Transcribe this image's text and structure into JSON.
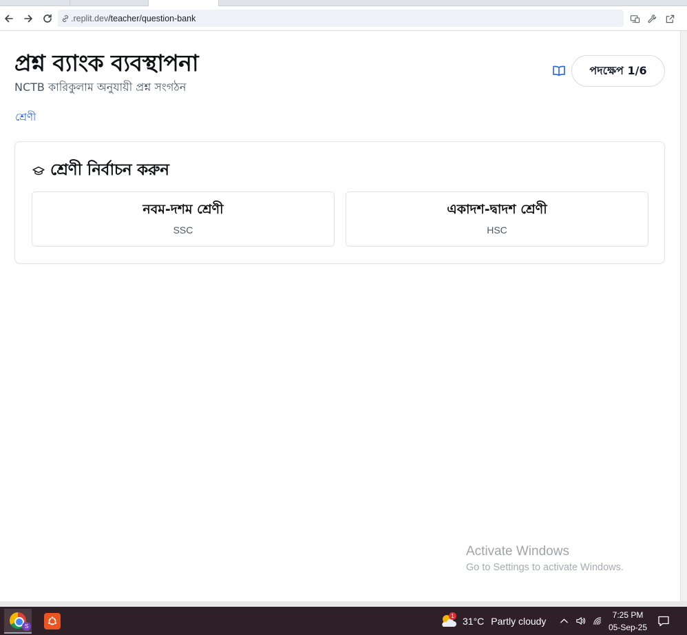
{
  "browser": {
    "url_prefix": ".replit.dev",
    "url_path": "/teacher/question-bank",
    "icons": [
      "back-icon",
      "forward-icon",
      "reload-icon",
      "link-icon",
      "install-app-icon",
      "wrench-icon",
      "open-new-window-icon"
    ]
  },
  "page": {
    "title": "প্রশ্ন ব্যাংক ব্যবস্থাপনা",
    "subtitle": "NCTB কারিকুলাম অনুযায়ী প্রশ্ন সংগঠন",
    "step_label": "পদক্ষেপ 1/6",
    "breadcrumb": "শ্রেণী",
    "card": {
      "title": "শ্রেণী নির্বাচন করুন",
      "options": [
        {
          "name": "নবম-দশম শ্রেণী",
          "code": "SSC"
        },
        {
          "name": "একাদশ-দ্বাদশ শ্রেণী",
          "code": "HSC"
        }
      ]
    },
    "accent_color": "#2563eb"
  },
  "watermark": {
    "line1": "Activate Windows",
    "line2": "Go to Settings to activate Windows."
  },
  "taskbar": {
    "weather_badge": "1",
    "temperature": "31°C",
    "condition": "Partly cloudy",
    "time": "7:25 PM",
    "date": "05-Sep-25",
    "profile_initial": "S"
  }
}
